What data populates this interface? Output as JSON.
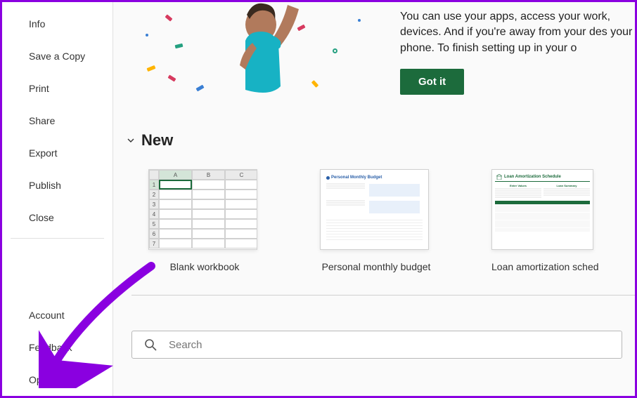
{
  "sidebar": {
    "top_items": [
      {
        "label": "Info"
      },
      {
        "label": "Save a Copy"
      },
      {
        "label": "Print"
      },
      {
        "label": "Share"
      },
      {
        "label": "Export"
      },
      {
        "label": "Publish"
      },
      {
        "label": "Close"
      }
    ],
    "bottom_items": [
      {
        "label": "Account"
      },
      {
        "label": "Feedback"
      },
      {
        "label": "Options"
      }
    ]
  },
  "banner": {
    "text": "You can use your apps, access your work, devices. And if you're away from your des your phone. To finish setting up in your o",
    "button_label": "Got it"
  },
  "new_section": {
    "title": "New",
    "templates": [
      {
        "name": "Blank workbook"
      },
      {
        "name": "Personal monthly budget"
      },
      {
        "name": "Loan amortization sched"
      }
    ]
  },
  "budget_thumb": {
    "title": "Personal Monthly Budget"
  },
  "loan_thumb": {
    "title": "Loan Amortization Schedule",
    "col1": "Enter Values",
    "col2": "Loan Summary"
  },
  "search": {
    "placeholder": "Search"
  },
  "colors": {
    "accent": "#1c6b3c",
    "border": "#8a00e0"
  }
}
